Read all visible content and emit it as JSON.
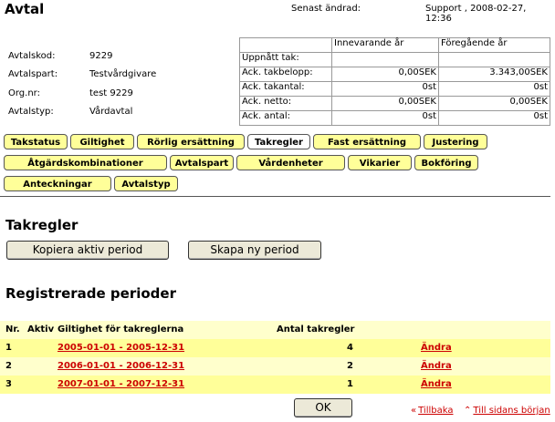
{
  "header": {
    "title": "Avtal",
    "last_changed_label": "Senast ändrad:",
    "last_changed_value": "Support , 2008-02-27, 12:36"
  },
  "agreement_info": [
    {
      "label": "Avtalskod:",
      "value": "9229"
    },
    {
      "label": "Avtalspart:",
      "value": "Testvårdgivare"
    },
    {
      "label": "Org.nr:",
      "value": "test 9229"
    },
    {
      "label": "Avtalstyp:",
      "value": "Vårdavtal"
    }
  ],
  "stats": {
    "col_current": "Innevarande år",
    "col_previous": "Föregående år",
    "rows": [
      {
        "label": "Uppnått tak:",
        "current": "",
        "previous": ""
      },
      {
        "label": "Ack. takbelopp:",
        "current": "0,00SEK",
        "previous": "3.343,00SEK"
      },
      {
        "label": "Ack. takantal:",
        "current": "0st",
        "previous": "0st"
      },
      {
        "label": "Ack. netto:",
        "current": "0,00SEK",
        "previous": "0,00SEK"
      },
      {
        "label": "Ack. antal:",
        "current": "0st",
        "previous": "0st"
      }
    ]
  },
  "tabs": [
    {
      "label": "Takstatus"
    },
    {
      "label": "Giltighet"
    },
    {
      "label": "Rörlig ersättning"
    },
    {
      "label": "Takregler",
      "active": true
    },
    {
      "label": "Fast ersättning"
    },
    {
      "label": "Justering"
    },
    {
      "label": "Åtgärdskombinationer"
    },
    {
      "label": "Avtalspart"
    },
    {
      "label": "Vårdenheter"
    },
    {
      "label": "Vikarier"
    },
    {
      "label": "Bokföring"
    },
    {
      "label": "Anteckningar"
    },
    {
      "label": "Avtalstyp"
    }
  ],
  "section": {
    "title": "Takregler",
    "copy_button": "Kopiera aktiv period",
    "new_button": "Skapa ny period"
  },
  "periods": {
    "title": "Registrerade perioder",
    "headers": {
      "nr": "Nr.",
      "active": "Aktiv",
      "validity": "Giltighet för takreglerna",
      "count": "Antal takregler"
    },
    "rows": [
      {
        "nr": "1",
        "validity": "2005-01-01 - 2005-12-31",
        "count": "4",
        "action": "Ändra"
      },
      {
        "nr": "2",
        "validity": "2006-01-01 - 2006-12-31",
        "count": "2",
        "action": "Ändra"
      },
      {
        "nr": "3",
        "validity": "2007-01-01 - 2007-12-31",
        "count": "1",
        "action": "Ändra"
      }
    ]
  },
  "footer": {
    "ok": "OK",
    "back_glyph": "«",
    "back": "Tillbaka",
    "top_glyph": "⌃",
    "top": "Till sidans början"
  },
  "colors": {
    "tab_bg": "#ffff99",
    "row_light": "#ffffcc",
    "row_dark": "#ffff99",
    "link": "#cc0000"
  }
}
